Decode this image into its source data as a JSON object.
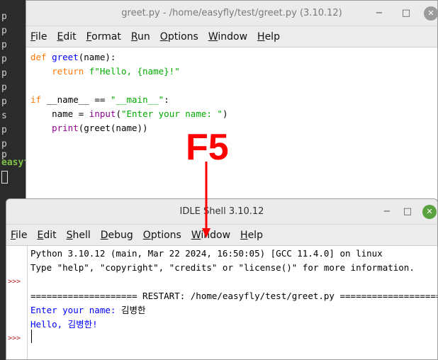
{
  "terminal": {
    "line_chars": [
      "p",
      "p",
      "p",
      "p",
      "p",
      "p",
      "p",
      "s",
      "p",
      "p",
      "p"
    ],
    "prompt": "easyf"
  },
  "editor": {
    "title": "greet.py - /home/easyfly/test/greet.py (3.10.12)",
    "menus": [
      "File",
      "Edit",
      "Format",
      "Run",
      "Options",
      "Window",
      "Help"
    ],
    "code": {
      "l1_kw": "def",
      "l1_fn": "greet",
      "l1_rest": "(name):",
      "l2_kw": "return",
      "l2_str": "f\"Hello, {name}!\"",
      "l4_kw": "if",
      "l4_mid": "__name__ ==",
      "l4_str": "\"__main__\"",
      "l4_end": ":",
      "l5_pre": "name =",
      "l5_blt": "input",
      "l5_open": "(",
      "l5_str": "\"Enter your name: \"",
      "l5_close": ")",
      "l6_blt": "print",
      "l6_rest": "(greet(name))"
    }
  },
  "shell": {
    "title": "IDLE Shell 3.10.12",
    "menus": [
      "File",
      "Edit",
      "Shell",
      "Debug",
      "Options",
      "Window",
      "Help"
    ],
    "prompt": ">>>",
    "lines": {
      "banner1": "Python 3.10.12 (main, Mar 22 2024, 16:50:05) [GCC 11.4.0] on linux",
      "banner2": "Type \"help\", \"copyright\", \"credits\" or \"license()\" for more information.",
      "restart": "==================== RESTART: /home/easyfly/test/greet.py ====================",
      "input_prompt": "Enter your name: ",
      "input_value": "김병한",
      "output": "Hello, 김병한!"
    }
  },
  "annotation": {
    "label": "F5",
    "color": "#ff0000"
  },
  "window_controls": {
    "minimize": "−",
    "maximize": "□",
    "close": "✕"
  }
}
